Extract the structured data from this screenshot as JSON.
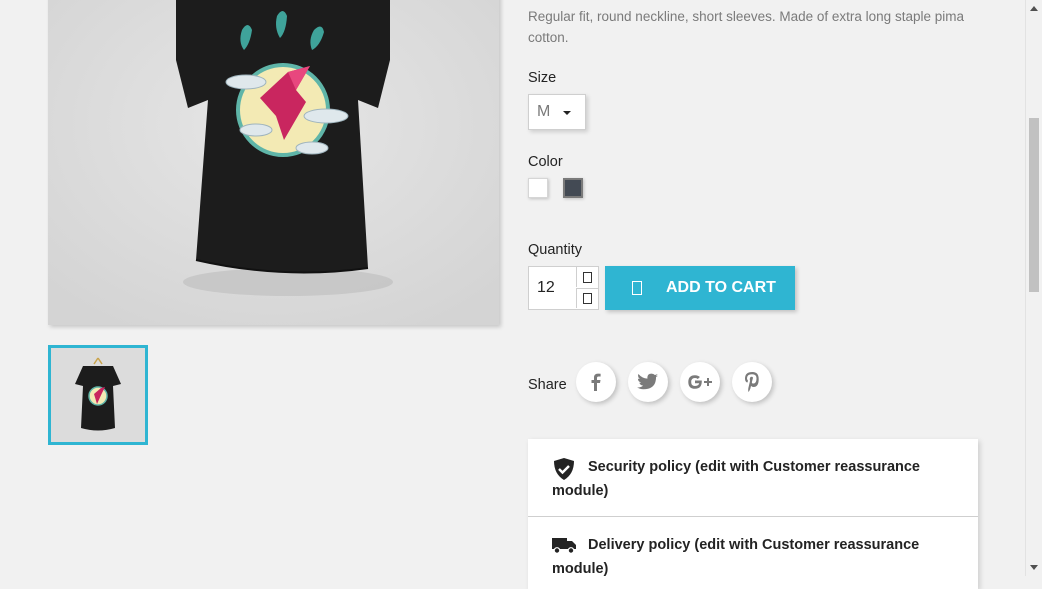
{
  "product": {
    "description": "Regular fit, round neckline, short sleeves. Made of extra long staple pima cotton."
  },
  "size": {
    "label": "Size",
    "selected": "M"
  },
  "color": {
    "label": "Color",
    "options": [
      {
        "name": "White",
        "hex": "#ffffff"
      },
      {
        "name": "Black",
        "hex": "#434a54"
      }
    ]
  },
  "quantity": {
    "label": "Quantity",
    "value": "12",
    "up_icon": "caret-up-icon",
    "down_icon": "caret-down-icon"
  },
  "add_to_cart": {
    "label": "ADD TO CART",
    "icon": "cart-icon",
    "color": "#2fb5d2"
  },
  "share": {
    "label": "Share",
    "networks": [
      "facebook",
      "twitter",
      "google-plus",
      "pinterest"
    ]
  },
  "reassurance": {
    "items": [
      {
        "icon": "shield-icon",
        "text": "Security policy (edit with Customer reassurance module)"
      },
      {
        "icon": "truck-icon",
        "text": "Delivery policy (edit with Customer reassurance module)"
      }
    ]
  }
}
